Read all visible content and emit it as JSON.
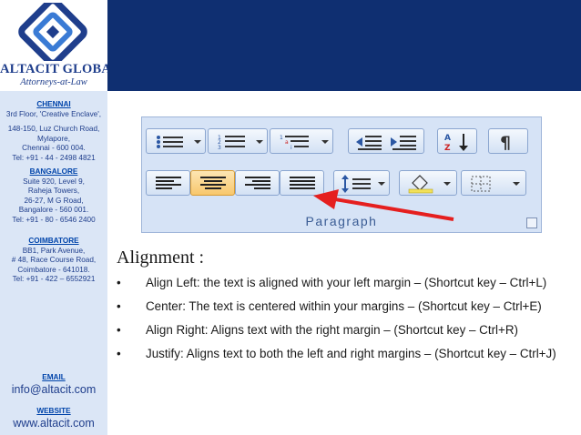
{
  "brand": {
    "name": "ALTACIT GLOBAL",
    "tagline": "Attorneys-at-Law",
    "colors": {
      "navy": "#0f2f71",
      "sidebar": "#dbe6f6",
      "link": "#0044aa"
    }
  },
  "offices": [
    {
      "city": "CHENNAI",
      "lines": [
        "3rd Floor, 'Creative Enclave',",
        "148-150, Luz Church Road,",
        "Mylapore,",
        "Chennai - 600 004.",
        "Tel: +91 - 44 - 2498 4821"
      ]
    },
    {
      "city": "BANGALORE",
      "lines": [
        "Suite 920, Level 9,",
        "Raheja Towers,",
        "26-27, M G Road,",
        "Bangalore - 560 001.",
        "Tel: +91 - 80 - 6546 2400"
      ]
    },
    {
      "city": "COIMBATORE",
      "lines": [
        "BB1, Park Avenue,",
        "# 48, Race Course Road,",
        "Coimbatore - 641018.",
        "Tel: +91 - 422 – 6552921"
      ]
    }
  ],
  "contact": {
    "email_label": "EMAIL",
    "email": "info@altacit.com",
    "website_label": "WEBSITE",
    "website": "www.altacit.com"
  },
  "ribbon": {
    "group_label": "Paragraph",
    "icons": [
      "bullets-icon",
      "numbering-icon",
      "multilevel-list-icon",
      "decrease-indent-icon",
      "increase-indent-icon",
      "sort-icon",
      "show-formatting-icon",
      "align-left-icon",
      "center-icon",
      "align-right-icon",
      "justify-icon",
      "line-spacing-icon",
      "shading-icon",
      "borders-icon"
    ],
    "active": "center-icon"
  },
  "content": {
    "title": "Alignment :",
    "bullets": [
      "Align Left:  the text is aligned with your left margin – (Shortcut key – Ctrl+L)",
      "Center:  The text is centered within your margins – (Shortcut key – Ctrl+E)",
      "Align Right:  Aligns text with the right margin – (Shortcut key – Ctrl+R)",
      "Justify:  Aligns text to both the left and right margins – (Shortcut key – Ctrl+J)"
    ]
  }
}
